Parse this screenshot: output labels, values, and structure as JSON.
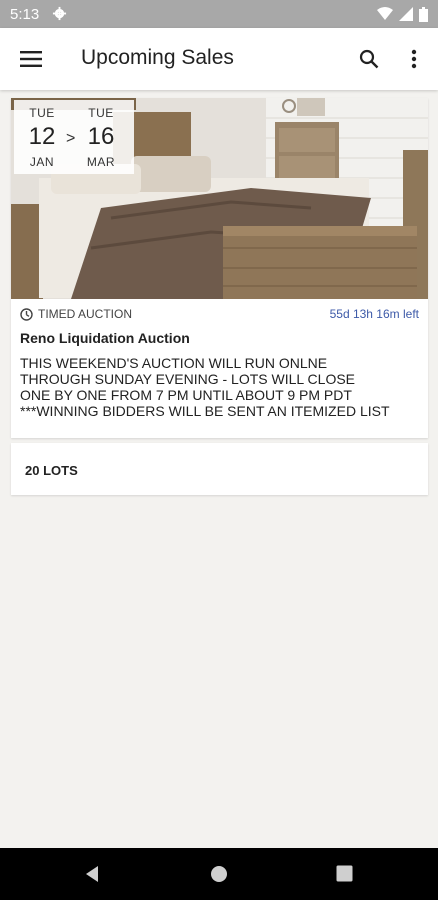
{
  "status_bar": {
    "time": "5:13",
    "icons": [
      "settings-gear-icon",
      "wifi-icon",
      "signal-icon",
      "battery-icon"
    ]
  },
  "app_bar": {
    "title": "Upcoming Sales",
    "icons": [
      "menu-icon",
      "search-icon",
      "more-vert-icon"
    ]
  },
  "sale": {
    "start": {
      "dow": "TUE",
      "day": "12",
      "month": "JAN"
    },
    "arrow": ">",
    "end": {
      "dow": "TUE",
      "day": "16",
      "month": "MAR"
    },
    "type": "TIMED AUCTION",
    "time_left": "55d 13h 16m left",
    "title": "Reno Liquidation Auction",
    "description_lines": [
      "THIS WEEKEND'S AUCTION WILL RUN ONLNE",
      "THROUGH SUNDAY EVENING - LOTS WILL CLOSE",
      "ONE BY ONE FROM 7 PM UNTIL ABOUT 9 PM PDT",
      "***WINNING BIDDERS WILL BE SENT AN ITEMIZED LIST"
    ]
  },
  "lots": {
    "label": "20 LOTS"
  },
  "colors": {
    "accent_link": "#3d5aa8",
    "status_bar": "#a8a8a8",
    "nav_bar": "#000000",
    "background": "#f3f2ef"
  }
}
